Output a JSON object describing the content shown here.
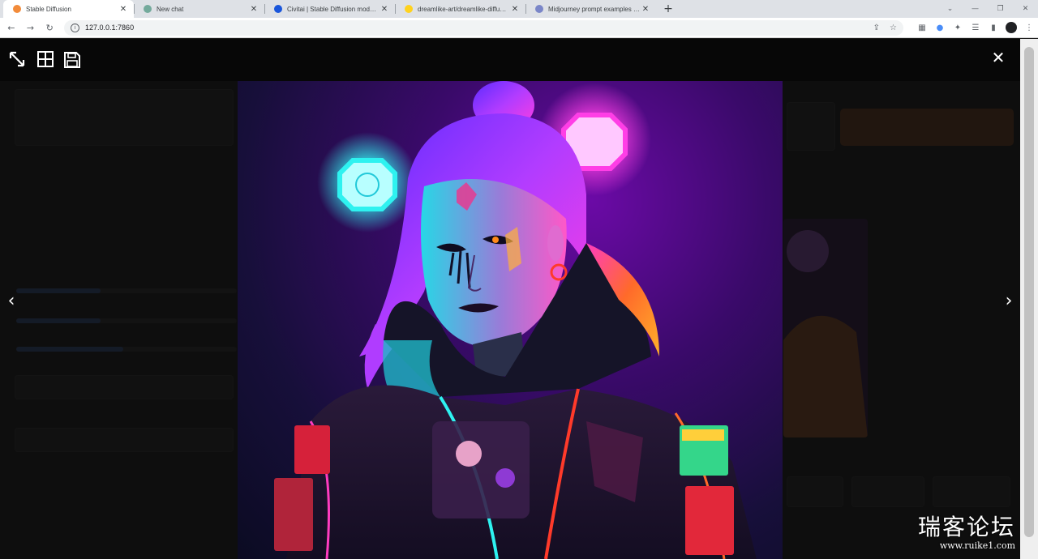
{
  "browser": {
    "tabs": [
      {
        "title": "Stable Diffusion",
        "active": true,
        "favicon_color": "#f28b3a"
      },
      {
        "title": "New chat",
        "active": false,
        "favicon_color": "#74aa9c"
      },
      {
        "title": "Civitai | Stable Diffusion models, e",
        "active": false,
        "favicon_color": "#1a56db"
      },
      {
        "title": "dreamlike-art/dreamlike-diffusion-",
        "active": false,
        "favicon_color": "#ffd21e"
      },
      {
        "title": "Midjourney prompt examples | Le",
        "active": false,
        "favicon_color": "#7a86c8"
      }
    ],
    "url": "127.0.0.1:7860"
  },
  "lightbox": {
    "tools": [
      "fullscreen-toggle-icon",
      "tile-grid-icon",
      "save-icon"
    ],
    "close_label": "✕",
    "prev_label": "‹",
    "next_label": "›"
  },
  "watermark": {
    "name": "瑞客论坛",
    "site": "www.ruike1.com"
  },
  "colors": {
    "accent_neon_pink": "#ff2bd6",
    "accent_neon_cyan": "#2ef2f0",
    "accent_neon_orange": "#ff6a2a"
  }
}
